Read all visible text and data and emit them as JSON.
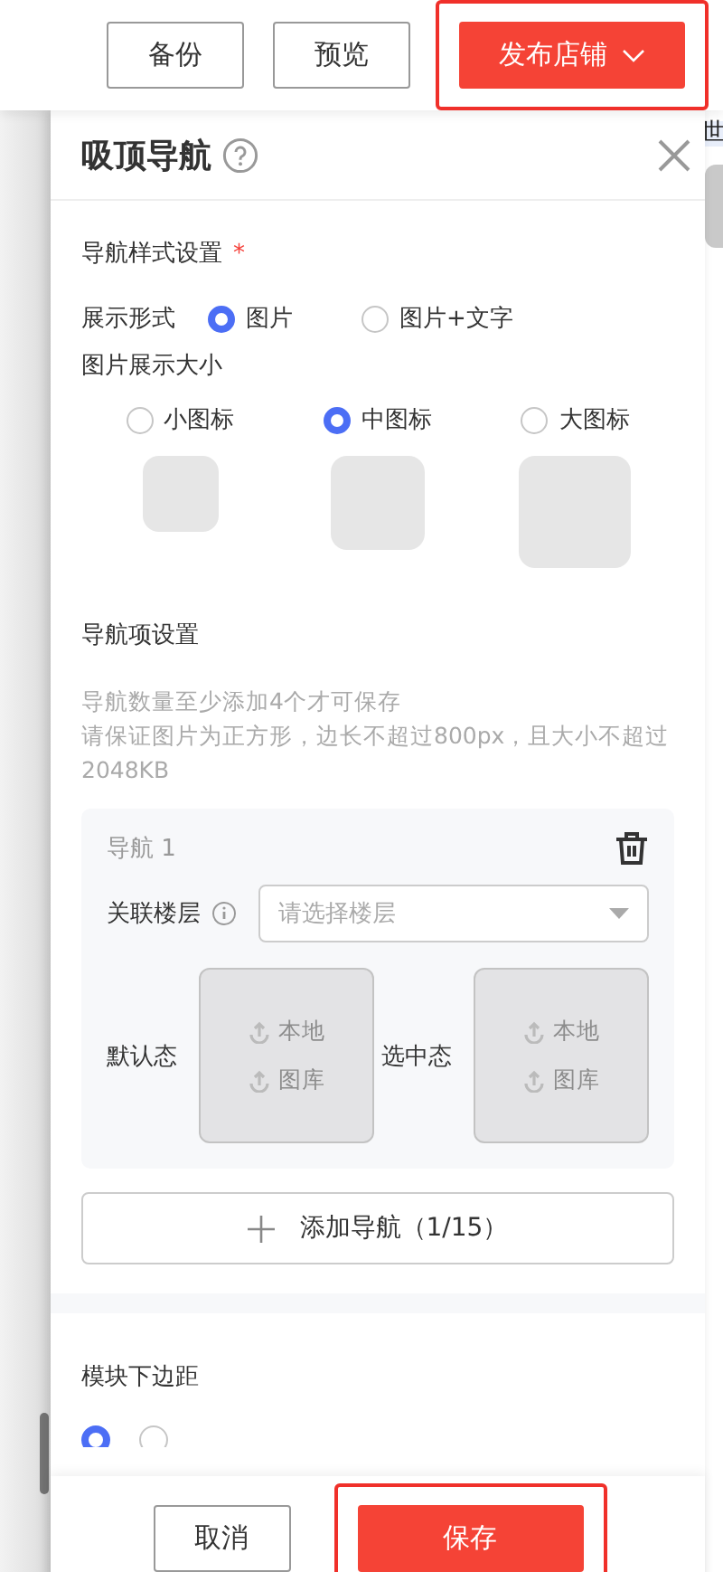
{
  "top_buttons": [
    {
      "label": "备份",
      "kind": "plain",
      "highlighted": false
    },
    {
      "label": "预览",
      "kind": "plain",
      "highlighted": false
    },
    {
      "label": "发布店铺",
      "kind": "primary",
      "highlighted": true
    }
  ],
  "side_peek": {
    "text": "世"
  },
  "panel": {
    "title": "吸顶导航",
    "style_section": {
      "title": "导航样式设置",
      "required_mark": "*",
      "display_label": "展示形式",
      "display_options": [
        {
          "label": "图片",
          "selected": true
        },
        {
          "label": "图片+文字",
          "selected": false
        }
      ],
      "size_label": "图片展示大小",
      "size_options": [
        {
          "label": "小图标",
          "selected": false
        },
        {
          "label": "中图标",
          "selected": true
        },
        {
          "label": "大图标",
          "selected": false
        }
      ]
    },
    "items_section": {
      "title": "导航项设置",
      "hints": [
        "导航数量至少添加4个才可保存",
        "请保证图片为正方形，边长不超过800px，且大小不超过2048KB"
      ],
      "items": [
        {
          "title": "导航 1",
          "floor_label": "关联楼层",
          "floor_placeholder": "请选择楼层",
          "states": [
            {
              "label": "默认态",
              "actions": [
                "本地",
                "图库"
              ]
            },
            {
              "label": "选中态",
              "actions": [
                "本地",
                "图库"
              ]
            }
          ]
        }
      ],
      "add_button": "添加导航（1/15）"
    },
    "margin_section": {
      "title": "模块下边距",
      "options": [
        {
          "selected": true
        },
        {
          "selected": false
        }
      ]
    }
  },
  "footer": [
    {
      "label": "取消",
      "kind": "plain",
      "highlighted": false
    },
    {
      "label": "保存",
      "kind": "primary",
      "highlighted": true
    }
  ]
}
